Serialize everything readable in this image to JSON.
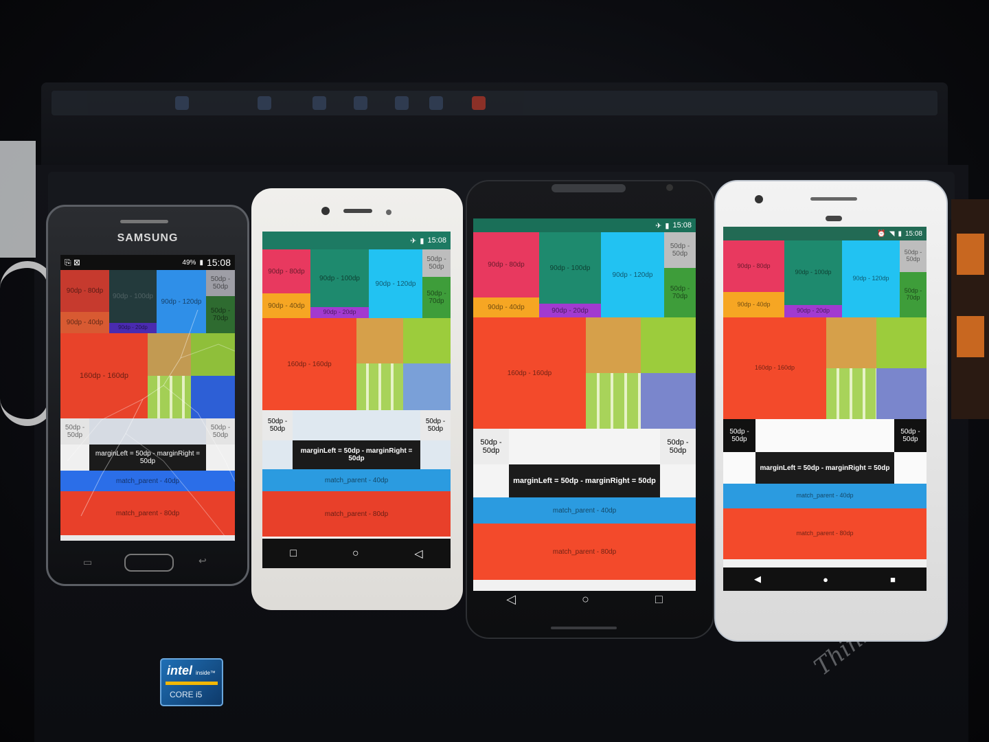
{
  "photo": {
    "props": {
      "intel_brand": "intel",
      "intel_inside": "inside™",
      "intel_core": "CORE i5",
      "laptop_brand": "ThinkPad"
    },
    "phones": [
      {
        "brand": "SAMSUNG",
        "status_time": "15:08",
        "status_battery": "49%",
        "labels": {
          "a": "90dp - 80dp",
          "b": "90dp - 100dp",
          "c": "90dp - 120dp",
          "d": "50dp - 50dp",
          "e": "90dp - 40dp",
          "f": "90dp - 20dp",
          "g": "50dp - 70dp",
          "big": "160dp - 160dp",
          "left50": "50dp - 50dp",
          "right50": "50dp - 50dp",
          "margin": "marginLeft = 50dp - marginRight = 50dp",
          "m40": "match_parent - 40dp",
          "m80": "match_parent - 80dp"
        }
      },
      {
        "status_time": "15:08",
        "labels": {
          "a": "90dp - 80dp",
          "b": "90dp - 100dp",
          "c": "90dp - 120dp",
          "d": "50dp - 50dp",
          "e": "90dp - 40dp",
          "f": "90dp - 20dp",
          "g": "50dp - 70dp",
          "big": "160dp - 160dp",
          "left50": "50dp - 50dp",
          "right50": "50dp - 50dp",
          "margin": "marginLeft = 50dp - marginRight = 50dp",
          "m40": "match_parent - 40dp",
          "m80": "match_parent - 80dp"
        }
      },
      {
        "status_time": "15:08",
        "labels": {
          "a": "90dp - 80dp",
          "b": "90dp - 100dp",
          "c": "90dp - 120dp",
          "d": "50dp - 50dp",
          "e": "90dp - 40dp",
          "f": "90dp - 20dp",
          "g": "50dp - 70dp",
          "big": "160dp - 160dp",
          "left50": "50dp - 50dp",
          "right50": "50dp - 50dp",
          "margin": "marginLeft = 50dp - marginRight = 50dp",
          "m40": "match_parent - 40dp",
          "m80": "match_parent - 80dp"
        }
      },
      {
        "status_time": "15:08",
        "labels": {
          "a": "90dp - 80dp",
          "b": "90dp - 100dp",
          "c": "90dp - 120dp",
          "d": "50dp - 50dp",
          "e": "90dp - 40dp",
          "f": "90dp - 20dp",
          "g": "50dp - 70dp",
          "big": "160dp - 160dp",
          "left50": "50dp - 50dp",
          "right50": "50dp - 50dp",
          "margin": "marginLeft = 50dp - marginRight = 50dp",
          "m40": "match_parent - 40dp",
          "m80": "match_parent - 80dp"
        }
      }
    ],
    "colors": {
      "pink": "#e8395f",
      "teal": "#1e8a6e",
      "cyan": "#22c2f2",
      "grey": "#bdbdbd",
      "orange": "#f6a623",
      "purple": "#a23ad0",
      "green": "#3e9d3a",
      "red": "#f34a2b",
      "blue": "#2b9be0",
      "lime": "#9ccc3c",
      "gold": "#d6a04a",
      "periwinkle": "#7a86cc"
    }
  }
}
